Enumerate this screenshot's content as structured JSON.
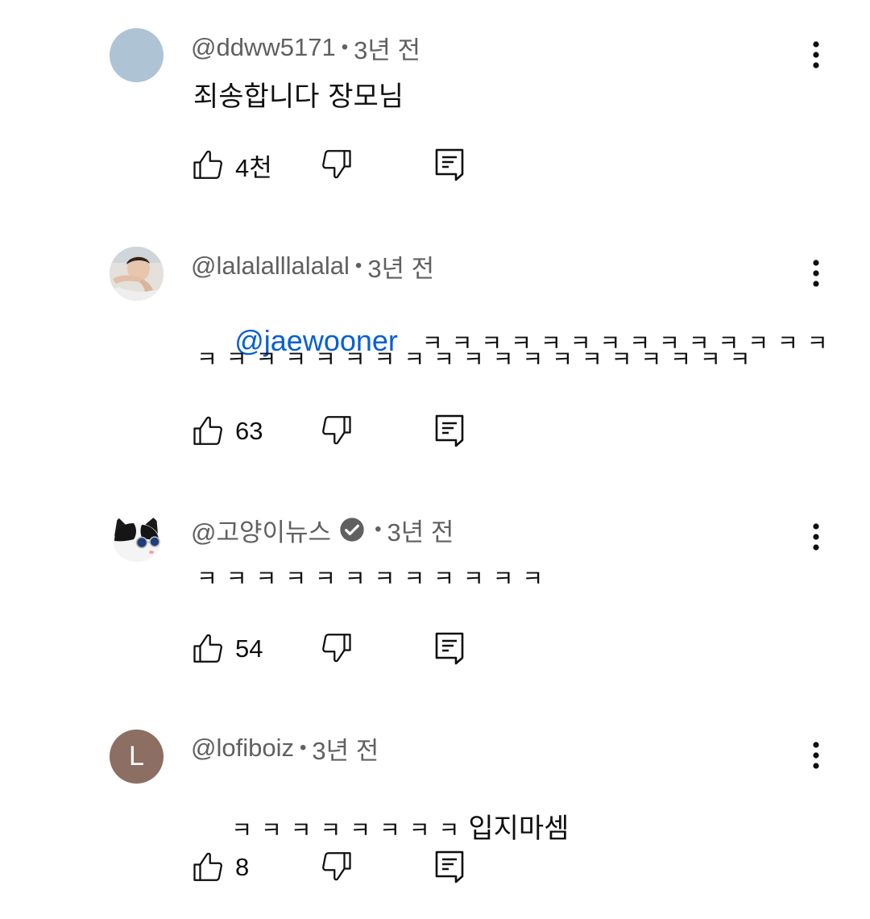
{
  "comments": [
    {
      "author": "@ddww5171",
      "time": "3년 전",
      "verified": false,
      "text": "죄송합니다 장모님",
      "likes": "4천",
      "avatar": {
        "type": "solid",
        "color": "#aec3d4"
      }
    },
    {
      "author": "@lalalalllalalal",
      "time": "3년 전",
      "verified": false,
      "mention": "@jaewooner",
      "text_line1": "ㅋㅋㅋㅋㅋㅋㅋㅋㅋㅋㅋㅋㅋㅋ",
      "text_line2": "ㅋㅋㅋㅋㅋㅋㅋㅋㅋㅋㅋㅋㅋㅋㅋㅋㅋㅋㅋ",
      "likes": "63",
      "avatar": {
        "type": "photo",
        "description": "person-photo"
      }
    },
    {
      "author": "@고양이뉴스",
      "time": "3년 전",
      "verified": true,
      "text": "ㅋㅋㅋㅋㅋㅋㅋㅋㅋㅋㅋㅋ",
      "likes": "54",
      "avatar": {
        "type": "photo",
        "description": "cat-with-sunglasses"
      }
    },
    {
      "author": "@lofiboiz",
      "time": "3년 전",
      "verified": false,
      "text_kk": "ㅋㅋㅋㅋㅋㅋㅋㅋ",
      "text_suffix": "입지마셈",
      "likes": "8",
      "avatar": {
        "type": "letter",
        "letter": "L",
        "color": "#8d6e63"
      }
    }
  ],
  "separator": "•",
  "icons": {
    "like": "thumbs-up-icon",
    "dislike": "thumbs-down-icon",
    "reply": "reply-comment-icon",
    "more": "more-vert-icon",
    "verified": "verified-check-icon"
  },
  "colors": {
    "text": "#0f0f0f",
    "meta": "#606060",
    "mention": "#065fd4"
  }
}
